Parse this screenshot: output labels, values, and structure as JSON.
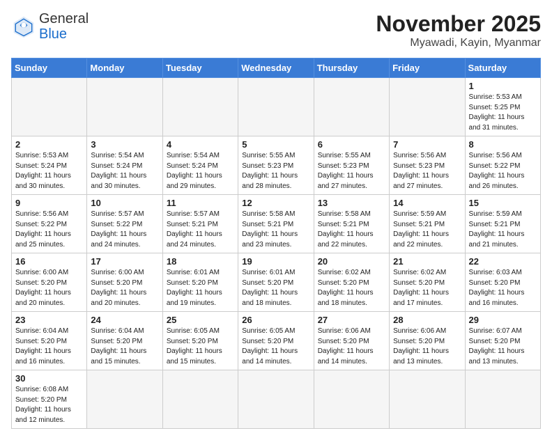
{
  "header": {
    "logo_general": "General",
    "logo_blue": "Blue",
    "month_year": "November 2025",
    "location": "Myawadi, Kayin, Myanmar"
  },
  "weekdays": [
    "Sunday",
    "Monday",
    "Tuesday",
    "Wednesday",
    "Thursday",
    "Friday",
    "Saturday"
  ],
  "weeks": [
    [
      {
        "day": "",
        "info": ""
      },
      {
        "day": "",
        "info": ""
      },
      {
        "day": "",
        "info": ""
      },
      {
        "day": "",
        "info": ""
      },
      {
        "day": "",
        "info": ""
      },
      {
        "day": "",
        "info": ""
      },
      {
        "day": "1",
        "info": "Sunrise: 5:53 AM\nSunset: 5:25 PM\nDaylight: 11 hours\nand 31 minutes."
      }
    ],
    [
      {
        "day": "2",
        "info": "Sunrise: 5:53 AM\nSunset: 5:24 PM\nDaylight: 11 hours\nand 30 minutes."
      },
      {
        "day": "3",
        "info": "Sunrise: 5:54 AM\nSunset: 5:24 PM\nDaylight: 11 hours\nand 30 minutes."
      },
      {
        "day": "4",
        "info": "Sunrise: 5:54 AM\nSunset: 5:24 PM\nDaylight: 11 hours\nand 29 minutes."
      },
      {
        "day": "5",
        "info": "Sunrise: 5:55 AM\nSunset: 5:23 PM\nDaylight: 11 hours\nand 28 minutes."
      },
      {
        "day": "6",
        "info": "Sunrise: 5:55 AM\nSunset: 5:23 PM\nDaylight: 11 hours\nand 27 minutes."
      },
      {
        "day": "7",
        "info": "Sunrise: 5:56 AM\nSunset: 5:23 PM\nDaylight: 11 hours\nand 27 minutes."
      },
      {
        "day": "8",
        "info": "Sunrise: 5:56 AM\nSunset: 5:22 PM\nDaylight: 11 hours\nand 26 minutes."
      }
    ],
    [
      {
        "day": "9",
        "info": "Sunrise: 5:56 AM\nSunset: 5:22 PM\nDaylight: 11 hours\nand 25 minutes."
      },
      {
        "day": "10",
        "info": "Sunrise: 5:57 AM\nSunset: 5:22 PM\nDaylight: 11 hours\nand 24 minutes."
      },
      {
        "day": "11",
        "info": "Sunrise: 5:57 AM\nSunset: 5:21 PM\nDaylight: 11 hours\nand 24 minutes."
      },
      {
        "day": "12",
        "info": "Sunrise: 5:58 AM\nSunset: 5:21 PM\nDaylight: 11 hours\nand 23 minutes."
      },
      {
        "day": "13",
        "info": "Sunrise: 5:58 AM\nSunset: 5:21 PM\nDaylight: 11 hours\nand 22 minutes."
      },
      {
        "day": "14",
        "info": "Sunrise: 5:59 AM\nSunset: 5:21 PM\nDaylight: 11 hours\nand 22 minutes."
      },
      {
        "day": "15",
        "info": "Sunrise: 5:59 AM\nSunset: 5:21 PM\nDaylight: 11 hours\nand 21 minutes."
      }
    ],
    [
      {
        "day": "16",
        "info": "Sunrise: 6:00 AM\nSunset: 5:20 PM\nDaylight: 11 hours\nand 20 minutes."
      },
      {
        "day": "17",
        "info": "Sunrise: 6:00 AM\nSunset: 5:20 PM\nDaylight: 11 hours\nand 20 minutes."
      },
      {
        "day": "18",
        "info": "Sunrise: 6:01 AM\nSunset: 5:20 PM\nDaylight: 11 hours\nand 19 minutes."
      },
      {
        "day": "19",
        "info": "Sunrise: 6:01 AM\nSunset: 5:20 PM\nDaylight: 11 hours\nand 18 minutes."
      },
      {
        "day": "20",
        "info": "Sunrise: 6:02 AM\nSunset: 5:20 PM\nDaylight: 11 hours\nand 18 minutes."
      },
      {
        "day": "21",
        "info": "Sunrise: 6:02 AM\nSunset: 5:20 PM\nDaylight: 11 hours\nand 17 minutes."
      },
      {
        "day": "22",
        "info": "Sunrise: 6:03 AM\nSunset: 5:20 PM\nDaylight: 11 hours\nand 16 minutes."
      }
    ],
    [
      {
        "day": "23",
        "info": "Sunrise: 6:04 AM\nSunset: 5:20 PM\nDaylight: 11 hours\nand 16 minutes."
      },
      {
        "day": "24",
        "info": "Sunrise: 6:04 AM\nSunset: 5:20 PM\nDaylight: 11 hours\nand 15 minutes."
      },
      {
        "day": "25",
        "info": "Sunrise: 6:05 AM\nSunset: 5:20 PM\nDaylight: 11 hours\nand 15 minutes."
      },
      {
        "day": "26",
        "info": "Sunrise: 6:05 AM\nSunset: 5:20 PM\nDaylight: 11 hours\nand 14 minutes."
      },
      {
        "day": "27",
        "info": "Sunrise: 6:06 AM\nSunset: 5:20 PM\nDaylight: 11 hours\nand 14 minutes."
      },
      {
        "day": "28",
        "info": "Sunrise: 6:06 AM\nSunset: 5:20 PM\nDaylight: 11 hours\nand 13 minutes."
      },
      {
        "day": "29",
        "info": "Sunrise: 6:07 AM\nSunset: 5:20 PM\nDaylight: 11 hours\nand 13 minutes."
      }
    ],
    [
      {
        "day": "30",
        "info": "Sunrise: 6:08 AM\nSunset: 5:20 PM\nDaylight: 11 hours\nand 12 minutes."
      },
      {
        "day": "",
        "info": ""
      },
      {
        "day": "",
        "info": ""
      },
      {
        "day": "",
        "info": ""
      },
      {
        "day": "",
        "info": ""
      },
      {
        "day": "",
        "info": ""
      },
      {
        "day": "",
        "info": ""
      }
    ]
  ]
}
